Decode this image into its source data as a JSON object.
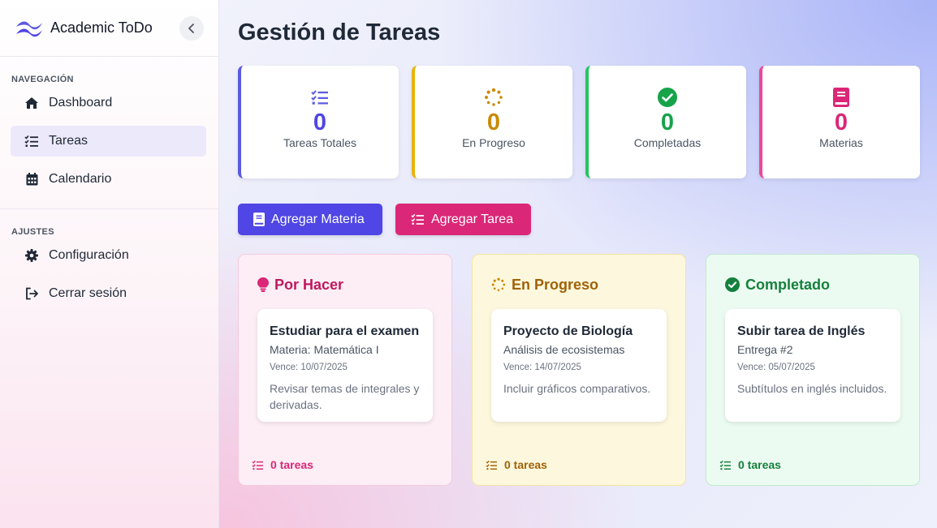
{
  "brand": {
    "name": "Academic ToDo"
  },
  "sidebar": {
    "nav_label": "NAVEGACIÓN",
    "nav_items": [
      {
        "label": "Dashboard",
        "icon": "home-icon"
      },
      {
        "label": "Tareas",
        "icon": "tasks-icon",
        "active": true
      },
      {
        "label": "Calendario",
        "icon": "calendar-icon"
      }
    ],
    "settings_label": "AJUSTES",
    "settings_items": [
      {
        "label": "Configuración",
        "icon": "gear-icon"
      },
      {
        "label": "Cerrar sesión",
        "icon": "logout-icon"
      }
    ]
  },
  "main": {
    "title": "Gestión de Tareas",
    "stats": [
      {
        "value": "0",
        "label": "Tareas Totales",
        "color": "#5b5be0",
        "icon": "tasks-icon"
      },
      {
        "value": "0",
        "label": "En Progreso",
        "color": "#ca8a04",
        "icon": "spinner-icon"
      },
      {
        "value": "0",
        "label": "Completadas",
        "color": "#16a34a",
        "icon": "check-circle-icon"
      },
      {
        "value": "0",
        "label": "Materias",
        "color": "#db2777",
        "icon": "book-icon"
      }
    ],
    "actions": {
      "add_subject": "Agregar Materia",
      "add_task": "Agregar Tarea"
    },
    "columns": [
      {
        "title": "Por Hacer",
        "color": "#be185d",
        "icon": "lightbulb-icon",
        "task": {
          "title": "Estudiar para el examen",
          "subtitle": "Materia: Matemática I",
          "due": "Vence: 10/07/2025",
          "description": "Revisar temas de integrales y derivadas."
        },
        "count": "0 tareas"
      },
      {
        "title": "En Progreso",
        "color": "#a16207",
        "icon": "spinner-icon",
        "task": {
          "title": "Proyecto de Biología",
          "subtitle": "Análisis de ecosistemas",
          "due": "Vence: 14/07/2025",
          "description": "Incluir gráficos comparativos."
        },
        "count": "0 tareas"
      },
      {
        "title": "Completado",
        "color": "#15803d",
        "icon": "check-circle-icon",
        "task": {
          "title": "Subir tarea de Inglés",
          "subtitle": "Entrega #2",
          "due": "Vence: 05/07/2025",
          "description": "Subtítulos en inglés incluidos."
        },
        "count": "0 tareas"
      }
    ]
  }
}
